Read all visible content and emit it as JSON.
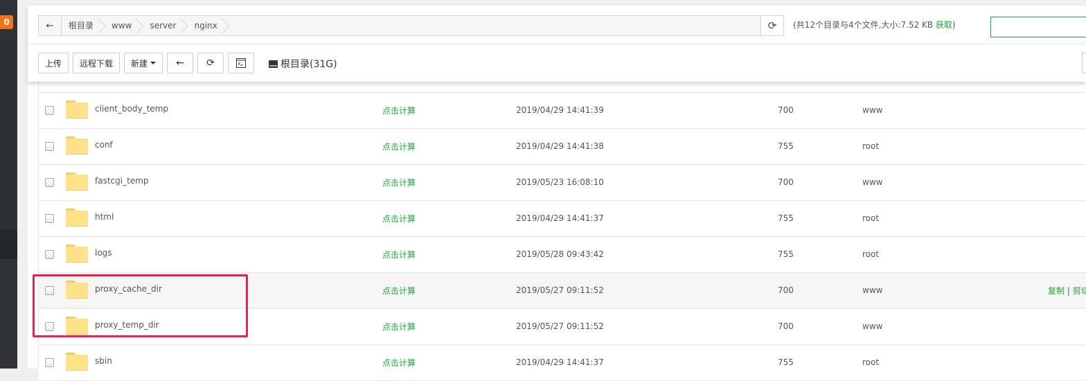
{
  "sidebar": {
    "badge": "0"
  },
  "breadcrumb": {
    "items": [
      "根目录",
      "www",
      "server",
      "nginx"
    ]
  },
  "summary": {
    "text": "(共12个目录与4个文件,大小:7.52 KB ",
    "link": "获取",
    "close": ")"
  },
  "toolbar": {
    "upload": "上传",
    "remote_download": "远程下载",
    "new": "新建",
    "disk_label": "根目录(31G)"
  },
  "files": {
    "calc_label": "点击计算",
    "rows": [
      {
        "name": "client_body_temp",
        "date": "2019/04/29 14:41:39",
        "perm": "700",
        "owner": "www"
      },
      {
        "name": "conf",
        "date": "2019/04/29 14:41:38",
        "perm": "755",
        "owner": "root"
      },
      {
        "name": "fastcgi_temp",
        "date": "2019/05/23 16:08:10",
        "perm": "700",
        "owner": "www"
      },
      {
        "name": "html",
        "date": "2019/04/29 14:41:37",
        "perm": "755",
        "owner": "root"
      },
      {
        "name": "logs",
        "date": "2019/05/28 09:43:42",
        "perm": "755",
        "owner": "root"
      },
      {
        "name": "proxy_cache_dir",
        "date": "2019/05/27 09:11:52",
        "perm": "700",
        "owner": "www"
      },
      {
        "name": "proxy_temp_dir",
        "date": "2019/05/27 09:11:52",
        "perm": "700",
        "owner": "www"
      },
      {
        "name": "sbin",
        "date": "2019/04/29 14:41:37",
        "perm": "755",
        "owner": "root"
      }
    ],
    "row_ops": {
      "copy": "复制",
      "separator": "|",
      "cut": "剪切"
    }
  }
}
